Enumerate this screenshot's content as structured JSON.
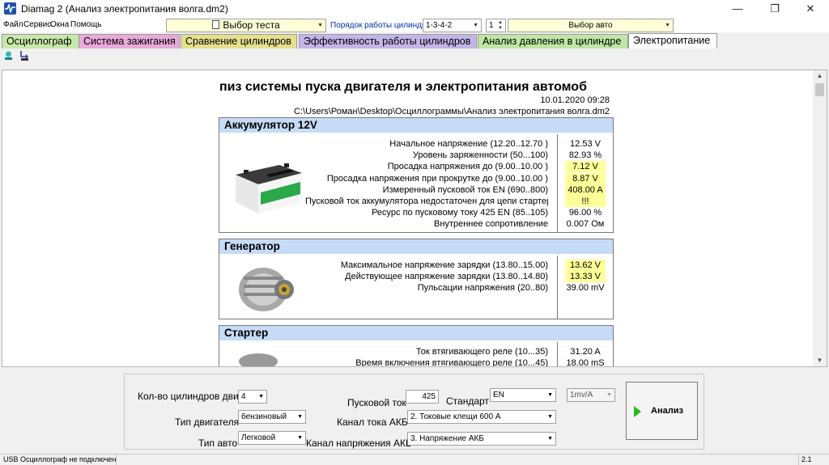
{
  "window": {
    "title": "Diamag 2 (Анализ электропитания волга.dm2)",
    "minimize": "—",
    "maximize": "❐",
    "close": "✕"
  },
  "menu": [
    "Файл",
    "Сервис",
    "Окна",
    "Помощь"
  ],
  "toolbar": {
    "test_select": "Выбор теста",
    "cyl_order_label": "Порядок работы цилиндров",
    "cyl_order_value": "1-3-4-2",
    "cyl_num": "1",
    "auto_select": "Выбор авто"
  },
  "tabs": [
    {
      "label": "Осциллограф",
      "color": "#c7e9a8"
    },
    {
      "label": "Система зажигания",
      "color": "#e9a9d9"
    },
    {
      "label": "Сравнение цилиндров",
      "color": "#e5e08e"
    },
    {
      "label": "Эффективность работы цилиндров",
      "color": "#c3b5e8"
    },
    {
      "label": "Анализ давления в цилиндре",
      "color": "#bde7a3"
    },
    {
      "label": "Электропитание",
      "color": "#ffffff"
    }
  ],
  "report": {
    "title": "пиз системы пуска двигателя и электропитания автомоб",
    "date": "10.01.2020 09:28",
    "path": "C:\\Users\\Роман\\Desktop\\Осциллограммы\\Анализ электропитания волга.dm2",
    "battery": {
      "header": "Аккумулятор 12V",
      "rows": [
        {
          "k": "Начальное напряжение (12.20..12.70 )",
          "v": "12.53 V",
          "hl": false
        },
        {
          "k": "Уровень заряженности (50...100)",
          "v": "82.93 %",
          "hl": false
        },
        {
          "k": "Просадка напряжения до (9.00..10.00 )",
          "v": "7.12 V",
          "hl": true
        },
        {
          "k": "Просадка напряжения при прокрутке до (9.00..10.00 )",
          "v": "8.87 V",
          "hl": true
        },
        {
          "k": "Измеренный пусковой ток  EN (690..800)",
          "v": "408.00 A",
          "hl": true
        },
        {
          "k": "Пусковой ток аккумулятора недостаточен для цепи стартера",
          "v": "!!!",
          "hl": true
        },
        {
          "k": "Ресурс по пусковому току  425 EN (85..105)",
          "v": "96.00 %",
          "hl": false
        },
        {
          "k": "Внутреннее сопротивление",
          "v": "0.007 Ом",
          "hl": false
        }
      ]
    },
    "generator": {
      "header": "Генератор",
      "rows": [
        {
          "k": "Максимальное напряжение зарядки  (13.80..15.00)",
          "v": "13.62 V",
          "hl": true
        },
        {
          "k": "Действующее напряжение зарядки  (13.80..14.80)",
          "v": "13.33 V",
          "hl": true
        },
        {
          "k": "Пульсации напряжения (20..80)",
          "v": "39.00 mV",
          "hl": false
        }
      ]
    },
    "starter": {
      "header": "Стартер",
      "rows": [
        {
          "k": "Ток втягивающего реле (10...35)",
          "v": "31.20 A",
          "hl": false
        },
        {
          "k": "Время включения втягивающего реле (10...45)",
          "v": "18.00 mS",
          "hl": false
        }
      ]
    }
  },
  "controls": {
    "cyl_count_label": "Кол-во цилиндров двиг",
    "cyl_count_value": "4",
    "engine_type_label": "Тип двигателя",
    "engine_type_value": "бензиновый",
    "auto_type_label": "Тип авто",
    "auto_type_value": "Легковой",
    "start_current_label": "Пусковой ток",
    "start_current_value": "425",
    "standard_label": "Стандарт",
    "standard_value": "EN",
    "akb_current_channel_label": "Канал тока АКБ",
    "akb_current_channel_value": "2. Токовые клещи 600 А",
    "akb_voltage_channel_label": "Канал напряжения АКБ",
    "akb_voltage_channel_value": "3. Напряжение АКБ",
    "scale_value": "1mv/A",
    "analyze_label": "Анализ"
  },
  "status": {
    "left": "USB Осциллограф не подключен",
    "right": "2.1"
  }
}
